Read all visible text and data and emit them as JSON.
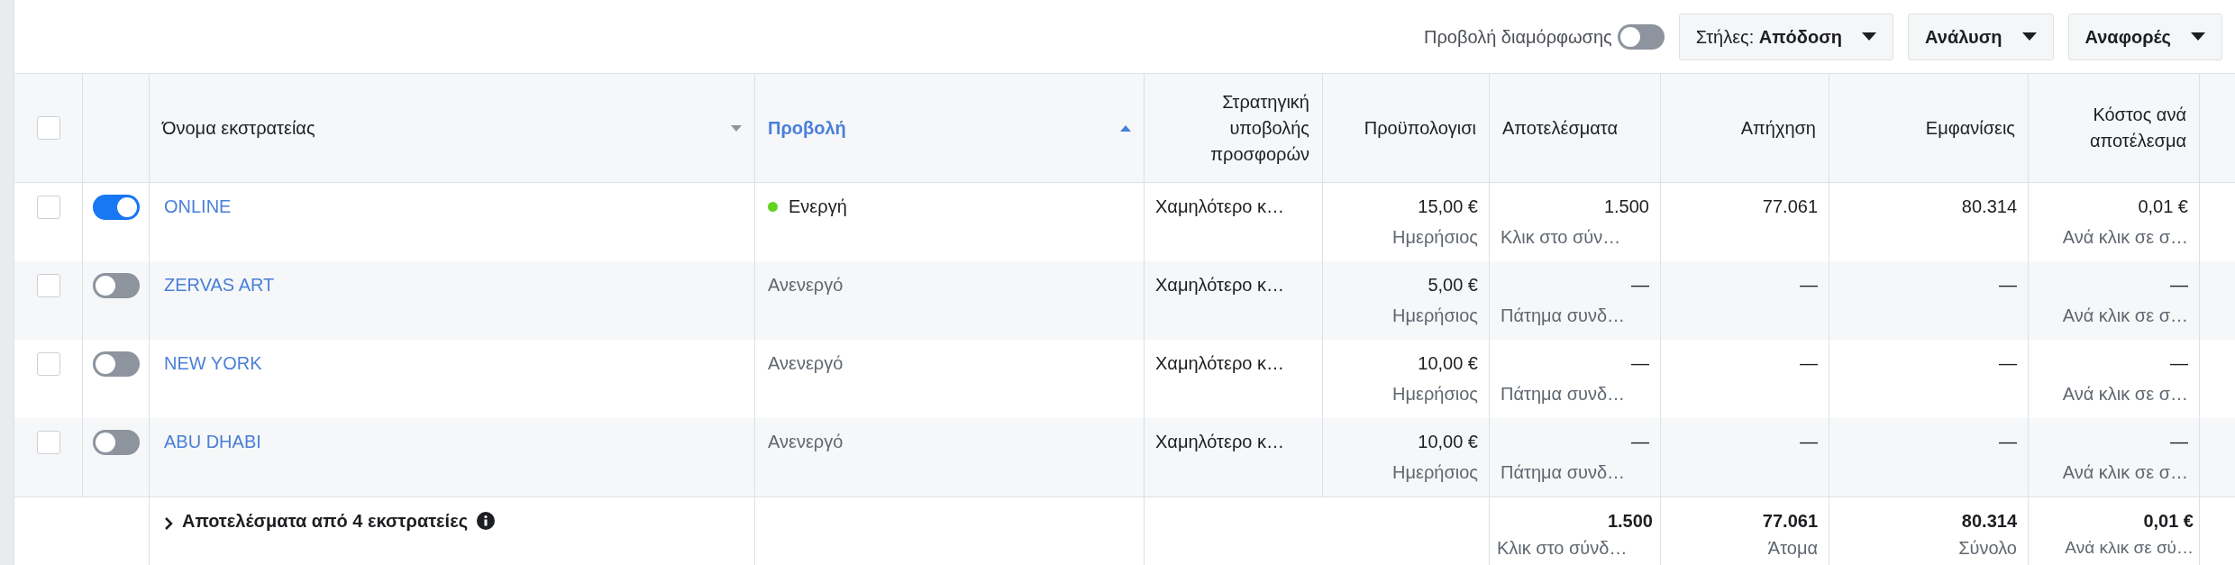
{
  "toolbar": {
    "config_label": "Προβολή διαμόρφωσης",
    "config_on": false,
    "buttons": [
      {
        "label": "Στήλες: **Απόδοση**"
      },
      {
        "label": "**Ανάλυση**"
      },
      {
        "label": "**Αναφορές**"
      }
    ]
  },
  "header_checkbox": {
    "checked": false
  },
  "columns": [
    {
      "label": "Όνομα εκστρατείας",
      "selected": false,
      "caret": true
    },
    {
      "label": "Προβολή",
      "selected": true,
      "caret": true
    },
    {
      "label": "Στρατηγική υποβολής προσφορών",
      "selected": false,
      "caret": false
    },
    {
      "label": "Προϋπολογισι",
      "selected": false,
      "caret": false
    },
    {
      "label": "Αποτελέσματα",
      "selected": false,
      "caret": false
    },
    {
      "label": "Απήχηση",
      "selected": false,
      "caret": false
    },
    {
      "label": "Εμφανίσεις",
      "selected": false,
      "caret": false
    },
    {
      "label": "Κόστος ανά αποτέλεσμα",
      "selected": false,
      "caret": false
    }
  ],
  "rows": [
    {
      "checked": false,
      "on": true,
      "name": "ONLINE",
      "status": "Ενεργή",
      "active": true,
      "bid_strategy": "Χαμηλότερο κ…",
      "budget": "15,00 €",
      "budget_type": "Ημερήσιος",
      "results": "1.500",
      "result_type": "Κλικ στο σύν…",
      "reach": "77.061",
      "impressions": "80.314",
      "cost": "0,01 €",
      "cost_type": "Ανά κλικ σε σ…"
    },
    {
      "checked": false,
      "on": false,
      "name": "ZERVAS ART",
      "status": "Ανενεργό",
      "active": false,
      "bid_strategy": "Χαμηλότερο κ…",
      "budget": "5,00 €",
      "budget_type": "Ημερήσιος",
      "results": "—",
      "result_type": "Πάτημα συνδ…",
      "reach": "—",
      "impressions": "—",
      "cost": "—",
      "cost_type": "Ανά κλικ σε σ…"
    },
    {
      "checked": false,
      "on": false,
      "name": "NEW YORK",
      "status": "Ανενεργό",
      "active": false,
      "bid_strategy": "Χαμηλότερο κ…",
      "budget": "10,00 €",
      "budget_type": "Ημερήσιος",
      "results": "—",
      "result_type": "Πάτημα συνδ…",
      "reach": "—",
      "impressions": "—",
      "cost": "—",
      "cost_type": "Ανά κλικ σε σ…"
    },
    {
      "checked": false,
      "on": false,
      "name": "ABU DHABI",
      "status": "Ανενεργό",
      "active": false,
      "bid_strategy": "Χαμηλότερο κ…",
      "budget": "10,00 €",
      "budget_type": "Ημερήσιος",
      "results": "—",
      "result_type": "Πάτημα συνδ…",
      "reach": "—",
      "impressions": "—",
      "cost": "—",
      "cost_type": "Ανά κλικ σε σ…"
    }
  ],
  "summary": {
    "label": "Αποτελέσματα από 4 εκστρατείες",
    "results": "1.500",
    "result_type": "Κλικ στο σύνδ…",
    "reach": "77.061",
    "reach_type": "Άτομα",
    "impressions": "80.314",
    "impressions_type": "Σύνολο",
    "cost": "0,01 €",
    "cost_type": "Ανά κλικ σε σύ…"
  }
}
